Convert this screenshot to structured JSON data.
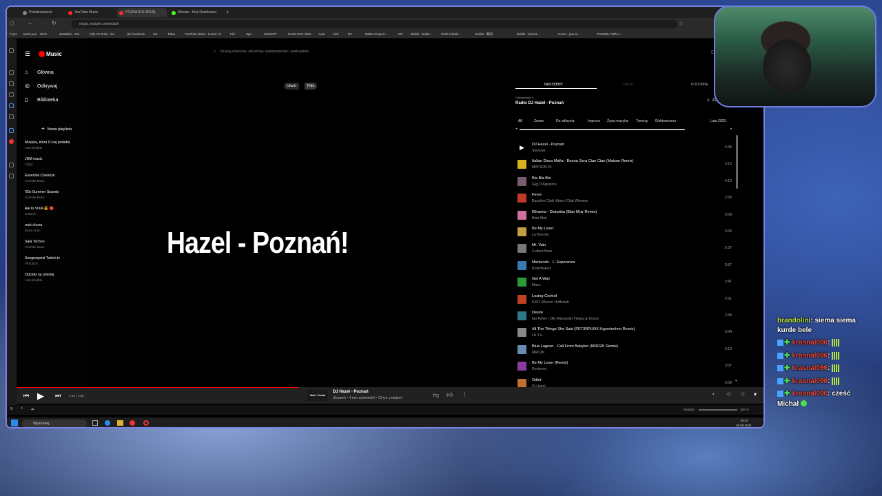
{
  "browser": {
    "tabs": [
      "Przedstawienie",
      "YouTube Music",
      "POZNAJCIE MOJĄ DZIEWCZYNĘ",
      "Stream - Kick Dashboard"
    ],
    "url": "music.youtube.com/watch",
    "bookmarks": [
      "C pro",
      "trade poe",
      "Strim",
      "sMadebo - Twi...",
      "(33) YouTube",
      "ins",
      "(2) Facebook",
      "net",
      "Tidea",
      "YouTube Music",
      "Home / X",
      "Flix",
      "Spo",
      "ChatGPT",
      "Portal OSK Start",
      "Auta",
      "Kick",
      "NC",
      "Malta Grupa U...",
      "Mit",
      "Builds - Nuller...",
      "Craft of Exile -",
      "Builds - 精讯",
      "Builds - kierzst...",
      "Home - poe.ni...",
      "PoE2DB, Path o..."
    ]
  },
  "app": {
    "logo": "Music",
    "search_placeholder": "Szukaj utworów, albumów, wykonawców i podcastów",
    "nav": [
      {
        "label": "Główna",
        "icon": "home-icon"
      },
      {
        "label": "Odkrywaj",
        "icon": "compass-icon"
      },
      {
        "label": "Biblioteka",
        "icon": "library-icon"
      }
    ],
    "new_playlist": "Nowa playlista",
    "playlists": [
      {
        "name": "Muzyka, która Ci się podoba",
        "sub": "Auto-playlista"
      },
      {
        "name": "JDM music",
        "sub": "고양님"
      },
      {
        "name": "Essential Classical",
        "sub": "YouTube Music"
      },
      {
        "name": "'90s Summer Sounds",
        "sub": "YouTube Music"
      },
      {
        "name": "Ale to VIXA 😎 🔴",
        "sub": "ZABZYK"
      },
      {
        "name": "rock chuva",
        "sub": "Bruno Artist"
      },
      {
        "name": "Sala Techno",
        "sub": "YouTube Music"
      },
      {
        "name": "Songrequest Twitch.tv",
        "sub": "FRVLBCK"
      },
      {
        "name": "Odcinki na później",
        "sub": "Auto-playlista"
      }
    ],
    "toggle": [
      "Utwór",
      "Film"
    ],
    "video_title": "Hazel - Poznań!",
    "right_tabs": [
      "NASTĘPNY",
      "TEKST",
      "PODOBNE"
    ],
    "queue_header": {
      "label": "Odtwarzanie z",
      "title": "Radio DJ Hazel - Poznań",
      "save": "Zapisz"
    },
    "filters": [
      "All",
      "Znane",
      "Do odkrycia",
      "Impreza",
      "Żywa muzyka",
      "Trening",
      "Elektroniczna",
      "Lata 2020."
    ],
    "tracks": [
      {
        "title": "DJ Hazel - Poznań",
        "artist": "Skwarek",
        "dur": "4:36",
        "color": "#000"
      },
      {
        "title": "Italian Disco Mafia - Buona Sera Ciao Ciao (Matson Remix)",
        "artist": "MATSON PL",
        "dur": "3:12",
        "color": "#d8b020"
      },
      {
        "title": "Bla Bla Bla",
        "artist": "Gigi D'Agostino",
        "dur": "4:16",
        "color": "#7a5a70"
      },
      {
        "title": "Fever",
        "artist": "Bassline Club Vibes i Club Winners",
        "dur": "2:55",
        "color": "#c03a2a"
      },
      {
        "title": "Rihanna - Disturbia (Blair Muir Remix)",
        "artist": "Blair Muir",
        "dur": "3:09",
        "color": "#d070a0"
      },
      {
        "title": "Be My Lover",
        "artist": "La Bouche",
        "dur": "4:02",
        "color": "#c0a040"
      },
      {
        "title": "Mr. Vain",
        "artist": "Culture Beat",
        "dur": "5:37",
        "color": "#777"
      },
      {
        "title": "Manieczki - L' Esperanza",
        "artist": "RulerBaked",
        "dur": "3:57",
        "color": "#3a7ab0"
      },
      {
        "title": "Get A Way",
        "artist": "Maxx",
        "dur": "3:47",
        "color": "#2a9a3a"
      },
      {
        "title": "Losing Control",
        "artist": "KI/KI i Marlon Hoffstadt",
        "dur": "2:51",
        "color": "#c04020"
      },
      {
        "title": "Desire",
        "artist": "Ian Asher i Olly Alexander (Years & Years)",
        "dur": "2:39",
        "color": "#2a7a8a"
      },
      {
        "title": "All The Things She Said (PET3RPUNX Hypertechno Remix)",
        "artist": "t.A.T.u.",
        "dur": "3:04",
        "color": "#888"
      },
      {
        "title": "Blue Lagoon - Call From Babylon (MRDZK Remix)",
        "artist": "MRDZK",
        "dur": "3:13",
        "color": "#6a8ab0"
      },
      {
        "title": "Be My Lover (Remix)",
        "artist": "Redemm",
        "dur": "3:07",
        "color": "#8a3aa0"
      },
      {
        "title": "Odlot",
        "artist": "Dj Hazel",
        "dur": "3:09",
        "color": "#c07030"
      }
    ],
    "player": {
      "time": "1:44 / 4:36",
      "thumb_text": "Hazel - Poznań",
      "title": "DJ Hazel - Poznań",
      "meta": "Skwarek • 4 mln wyświetleń • 21 tys. polubień",
      "progress": 0.377
    }
  },
  "os": {
    "search": "Wyszukaj",
    "time": "18:43",
    "date": "25.09.2024",
    "volume": "100 %",
    "resolution": "Rewizja"
  },
  "chat": [
    {
      "user": "brandolini",
      "msg": ": siema siema",
      "cont": "kurde bele",
      "color": "#b5e33a"
    },
    {
      "user": "krasnal096",
      "msg": ":",
      "emote": true,
      "color": "#e8483a"
    },
    {
      "user": "krasnal096",
      "msg": ":",
      "emote": true,
      "color": "#e8483a"
    },
    {
      "user": "krasnal096",
      "msg": ":",
      "emote": true,
      "color": "#e8483a"
    },
    {
      "user": "krasnal096",
      "msg": ":",
      "emote": true,
      "color": "#e8483a"
    },
    {
      "user": "krasnal096",
      "msg": ": cześć",
      "cont": "Michał",
      "color": "#e8483a"
    }
  ]
}
